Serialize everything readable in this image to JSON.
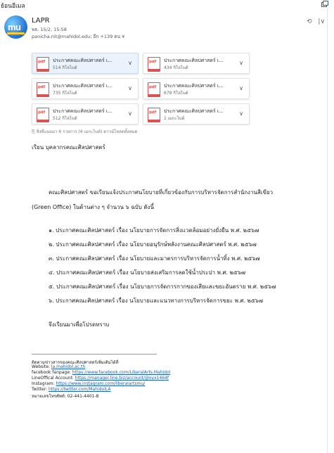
{
  "window": {
    "title": "ย้อนอีเมล"
  },
  "header": {
    "sender": "LAPR",
    "date": "พธ. 15/2, 15:58",
    "recipients": "panicha.nit@mahidol.edu; อีก +139 คน ¥",
    "actions": [
      "⟲",
      "|∨"
    ]
  },
  "attachments": [
    {
      "name": "ประกาศคณะศิลปศาสตร์ เ...",
      "size": "514 กิโลไบต์"
    },
    {
      "name": "ประกาศคณะศิลปศาสตร์ เ...",
      "size": "434 กิโลไบต์"
    },
    {
      "name": "ประกาศคณะศิลปศาสตร์ เ...",
      "size": "735 กิโลไบต์"
    },
    {
      "name": "ประกาศคณะศิลปศาสตร์ เ...",
      "size": "679 กิโลไบต์"
    },
    {
      "name": "ประกาศคณะศิลปศาสตร์ เ...",
      "size": "512 กิโลไบต์"
    },
    {
      "name": "ประกาศคณะศิลปศาสตร์ เ...",
      "size": "1 เมกะไบต์"
    }
  ],
  "attachment_summary": "สิ่งที่แนบมา 6 รายการ (4 เมกะไบต์)   ดาวน์โหลดทั้งหมด",
  "body": {
    "greeting": "เรียน  บุคลากรคณะศิลปศาสตร์",
    "para1_line1": "คณะศิลปศาสตร์ ขอเรียนแจ้งประกาศนโยบายที่เกี่ยวข้องกับการบริหารจัดการสำนักงานสีเขียว",
    "para1_line2": "(Green Office) ในด้านต่าง ๆ จำนวน ๖ ฉบับ ดังนี้",
    "items": [
      "๑. ประกาศคณะศิลปศาสตร์ เรื่อง นโยบายการจัดการสิ่งแวดล้อมอย่างยั่งยืน พ.ศ. ๒๕๖๗",
      "๒. ประกาศคณะศิลปศาสตร์ เรื่อง นโยบายอนุรักษ์พลังงานคณะศิลปศาสตร์ พ.ศ. ๒๕๖๗",
      "๓. ประกาศคณะศิลปศาสตร์ เรื่อง นโยบายและมาตรการบริหารจัดการน้ำทิ้ง พ.ศ. ๒๕๖๗",
      "๔. ประกาศคณะศิลปศาสตร์ เรื่อง นโยบายส่งเสริมการลดใช้น้ำประปา พ.ศ. ๒๕๖๗",
      "๕. ประกาศคณะศิลปศาสตร์ เรื่อง นโยบายการจัดการกากของเสียและขยะอันตราย พ.ศ. ๒๕๖๗",
      "๖. ประกาศคณะศิลปศาสตร์ เรื่อง นโยบายและแนวทางการบริหารจัดการขยะ พ.ศ. ๒๕๖๗"
    ],
    "closing": "จึงเรียนมาเพื่อโปรดทราบ"
  },
  "signature": {
    "heading": "ติดตามข่าวสารของคณะศิลปศาสตร์เพิ่มเติมได้ที่",
    "website_label": "Website: ",
    "website": "la.mahidol.ac.th",
    "facebook_label": "facebook fanpage: ",
    "facebook": "https://www.facebook.com/LiberalArts.Mahidol",
    "line_label": "LineOffical Account: ",
    "line": "https://manager.line.biz/account/@oyx1464f",
    "instagram_label": "Instagram: ",
    "instagram": "https://www.instagram.com/liberalartsmu/",
    "twitter_label": "Twitter: ",
    "twitter": "https://twitter.com/MahidolLA",
    "phone": "หมายเลขโทรศัพท์: 02-441-4401-8"
  }
}
